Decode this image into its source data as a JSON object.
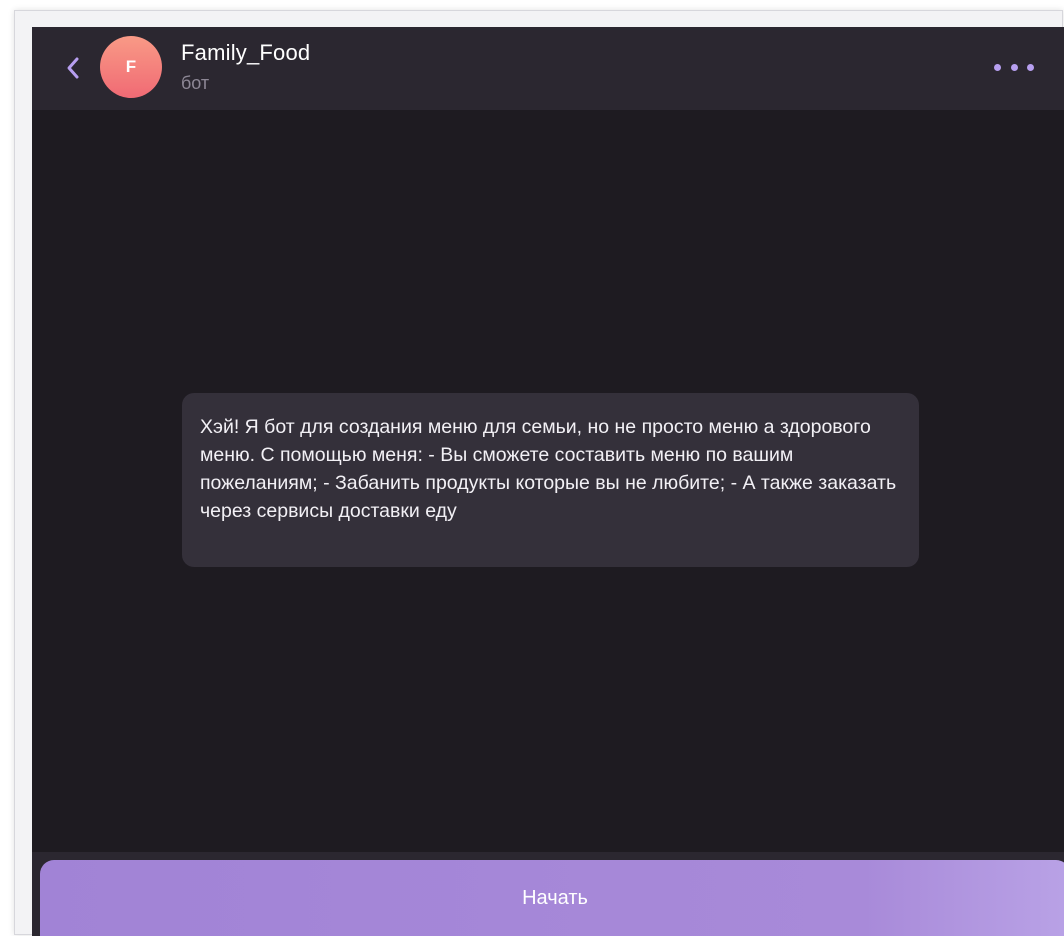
{
  "header": {
    "avatar_letter": "F",
    "title": "Family_Food",
    "subtitle": "бот",
    "back_icon": "chevron-left-icon",
    "more_icon": "more-horizontal-icon"
  },
  "chat": {
    "messages": [
      {
        "text": "Хэй! Я бот для создания меню для семьи, но не просто меню а здорового меню. С помощью меня: - Вы сможете составить меню по вашим пожеланиям; - Забанить продукты которые вы не любите; - А также заказать через сервисы доставки еду"
      }
    ]
  },
  "footer": {
    "start_label": "Начать"
  },
  "colors": {
    "accent": "#a88ad9",
    "background": "#1e1b21",
    "header": "#2b2730",
    "bubble": "#34303a",
    "avatar_gradient_top": "#f99a86",
    "avatar_gradient_bottom": "#f06a74"
  }
}
